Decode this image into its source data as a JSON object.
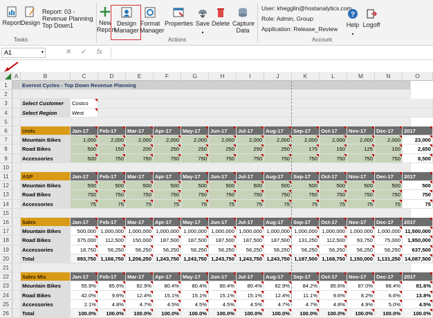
{
  "ribbon": {
    "buttons": [
      {
        "name": "report-button",
        "label": "Report",
        "icon": "report-icon"
      },
      {
        "name": "design-button",
        "label": "Design",
        "icon": "design-icon"
      },
      {
        "name": "report-select",
        "label": "Report: 03 - Revenue Planning Top Down1",
        "icon": "dropdown-icon"
      },
      {
        "name": "new-report-button",
        "label": "New Report",
        "icon": "plus-icon"
      },
      {
        "name": "design-manager-button",
        "label": "Design Manager",
        "icon": "design-manager-icon"
      },
      {
        "name": "format-manager-button",
        "label": "Format Manager",
        "icon": "format-manager-icon"
      },
      {
        "name": "properties-button",
        "label": "Properties",
        "icon": "properties-icon"
      },
      {
        "name": "save-button",
        "label": "Save",
        "icon": "save-icon"
      },
      {
        "name": "delete-button",
        "label": "Delete",
        "icon": "delete-icon"
      },
      {
        "name": "capture-data-button",
        "label": "Capture Data",
        "icon": "capture-icon"
      },
      {
        "name": "help-button",
        "label": "Help",
        "icon": "help-icon"
      },
      {
        "name": "logoff-button",
        "label": "Logoff",
        "icon": "logoff-icon"
      }
    ],
    "groups": {
      "tasks": "Tasks",
      "actions": "Actions",
      "account": "Account"
    },
    "account": {
      "user": "User: khegglin@hostanalytics.com",
      "role": "Role: Admin, Group:",
      "application": "Application: Release_Review"
    }
  },
  "formula_bar": {
    "name_box": "A1",
    "cancel": "✕",
    "enter": "✓",
    "fx": "fx",
    "value": ""
  },
  "columns": [
    "A",
    "B",
    "C",
    "D",
    "E",
    "F",
    "G",
    "H",
    "I",
    "J",
    "K",
    "L",
    "M",
    "N",
    "O"
  ],
  "sheet": {
    "title": "Everest Cycles - Top Down Revenue Planning",
    "select_customer_label": "Select Customer",
    "select_customer_value": "Costco",
    "select_region_label": "Select Region",
    "select_region_value": "West",
    "months": [
      "Jan-17",
      "Feb-17",
      "Mar-17",
      "Apr-17",
      "May-17",
      "Jun-17",
      "Jul-17",
      "Aug-17",
      "Sep-17",
      "Oct-17",
      "Nov-17",
      "Dec-17",
      "2017"
    ],
    "sections": [
      {
        "label": "Units",
        "header_row": 6,
        "rows": [
          {
            "row": 7,
            "label": "Mountain Bikes",
            "values": [
              "1,000",
              "2,000",
              "2,000",
              "2,000",
              "2,000",
              "2,000",
              "2,000",
              "2,000",
              "2,000",
              "2,000",
              "2,000",
              "2,000",
              "23,000"
            ]
          },
          {
            "row": 8,
            "label": "Road Bikes",
            "values": [
              "500",
              "150",
              "200",
              "250",
              "250",
              "250",
              "250",
              "250",
              "175",
              "150",
              "125",
              "100",
              "2,650"
            ]
          },
          {
            "row": 9,
            "label": "Accessories",
            "values": [
              "500",
              "750",
              "750",
              "750",
              "750",
              "750",
              "750",
              "750",
              "750",
              "750",
              "750",
              "750",
              "8,500"
            ]
          }
        ]
      },
      {
        "label": "ASP",
        "header_row": 11,
        "rows": [
          {
            "row": 12,
            "label": "Mountain Bikes",
            "values": [
              "500",
              "500",
              "500",
              "500",
              "500",
              "500",
              "500",
              "500",
              "500",
              "500",
              "500",
              "500",
              "500"
            ]
          },
          {
            "row": 13,
            "label": "Road Bikes",
            "values": [
              "750",
              "750",
              "750",
              "750",
              "750",
              "750",
              "750",
              "750",
              "750",
              "750",
              "750",
              "750",
              "750"
            ]
          },
          {
            "row": 14,
            "label": "Accessories",
            "values": [
              "75",
              "75",
              "75",
              "75",
              "75",
              "75",
              "75",
              "75",
              "75",
              "75",
              "75",
              "75",
              "75"
            ]
          }
        ]
      },
      {
        "label": "Sales",
        "header_row": 16,
        "rows": [
          {
            "row": 17,
            "label": "Mountain Bikes",
            "values": [
              "500,000",
              "1,000,000",
              "1,000,000",
              "1,000,000",
              "1,000,000",
              "1,000,000",
              "1,000,000",
              "1,000,000",
              "1,000,000",
              "1,000,000",
              "1,000,000",
              "1,000,000",
              "11,500,000"
            ]
          },
          {
            "row": 18,
            "label": "Road Bikes",
            "values": [
              "375,000",
              "112,500",
              "150,000",
              "187,500",
              "187,500",
              "187,500",
              "187,500",
              "187,500",
              "131,250",
              "112,500",
              "93,750",
              "75,000",
              "1,950,000"
            ]
          },
          {
            "row": 19,
            "label": "Accessories",
            "values": [
              "18,750",
              "56,250",
              "56,250",
              "56,250",
              "56,250",
              "56,250",
              "56,250",
              "56,250",
              "56,250",
              "56,250",
              "56,250",
              "56,250",
              "637,500"
            ]
          },
          {
            "row": 20,
            "label": "Total",
            "values": [
              "893,750",
              "1,168,750",
              "1,206,250",
              "1,243,750",
              "1,243,750",
              "1,243,750",
              "1,243,750",
              "1,243,750",
              "1,187,500",
              "1,168,750",
              "1,150,000",
              "1,131,250",
              "14,087,500"
            ]
          }
        ]
      },
      {
        "label": "Sales Mix",
        "header_row": 22,
        "rows": [
          {
            "row": 23,
            "label": "Mountain Bikes",
            "values": [
              "55.9%",
              "85.6%",
              "82.9%",
              "80.4%",
              "80.4%",
              "80.4%",
              "80.4%",
              "82.9%",
              "84.2%",
              "85.6%",
              "87.0%",
              "88.4%",
              "81.6%"
            ]
          },
          {
            "row": 24,
            "label": "Road Bikes",
            "values": [
              "42.0%",
              "9.6%",
              "12.4%",
              "15.1%",
              "15.1%",
              "15.1%",
              "15.1%",
              "12.4%",
              "11.1%",
              "9.6%",
              "8.2%",
              "6.6%",
              "13.8%"
            ]
          },
          {
            "row": 25,
            "label": "Accessories",
            "values": [
              "2.1%",
              "4.8%",
              "4.7%",
              "4.5%",
              "4.5%",
              "4.5%",
              "4.5%",
              "4.7%",
              "4.7%",
              "4.8%",
              "4.9%",
              "5.0%",
              "4.5%"
            ]
          },
          {
            "row": 26,
            "label": "Total",
            "values": [
              "100.0%",
              "100.0%",
              "100.0%",
              "100.0%",
              "100.0%",
              "100.0%",
              "100.0%",
              "100.0%",
              "100.0%",
              "100.0%",
              "100.0%",
              "100.0%",
              "100.0%"
            ]
          }
        ]
      }
    ]
  },
  "colors": {
    "section_label_bg": "#d99a15",
    "header_bg": "#6d6d6d",
    "input_bg": "#c7d3b8",
    "title_bg": "#cfcfcf",
    "label_bg": "#dedede",
    "error_tri": "#c00000",
    "highlight_border": "#d32f2f"
  }
}
